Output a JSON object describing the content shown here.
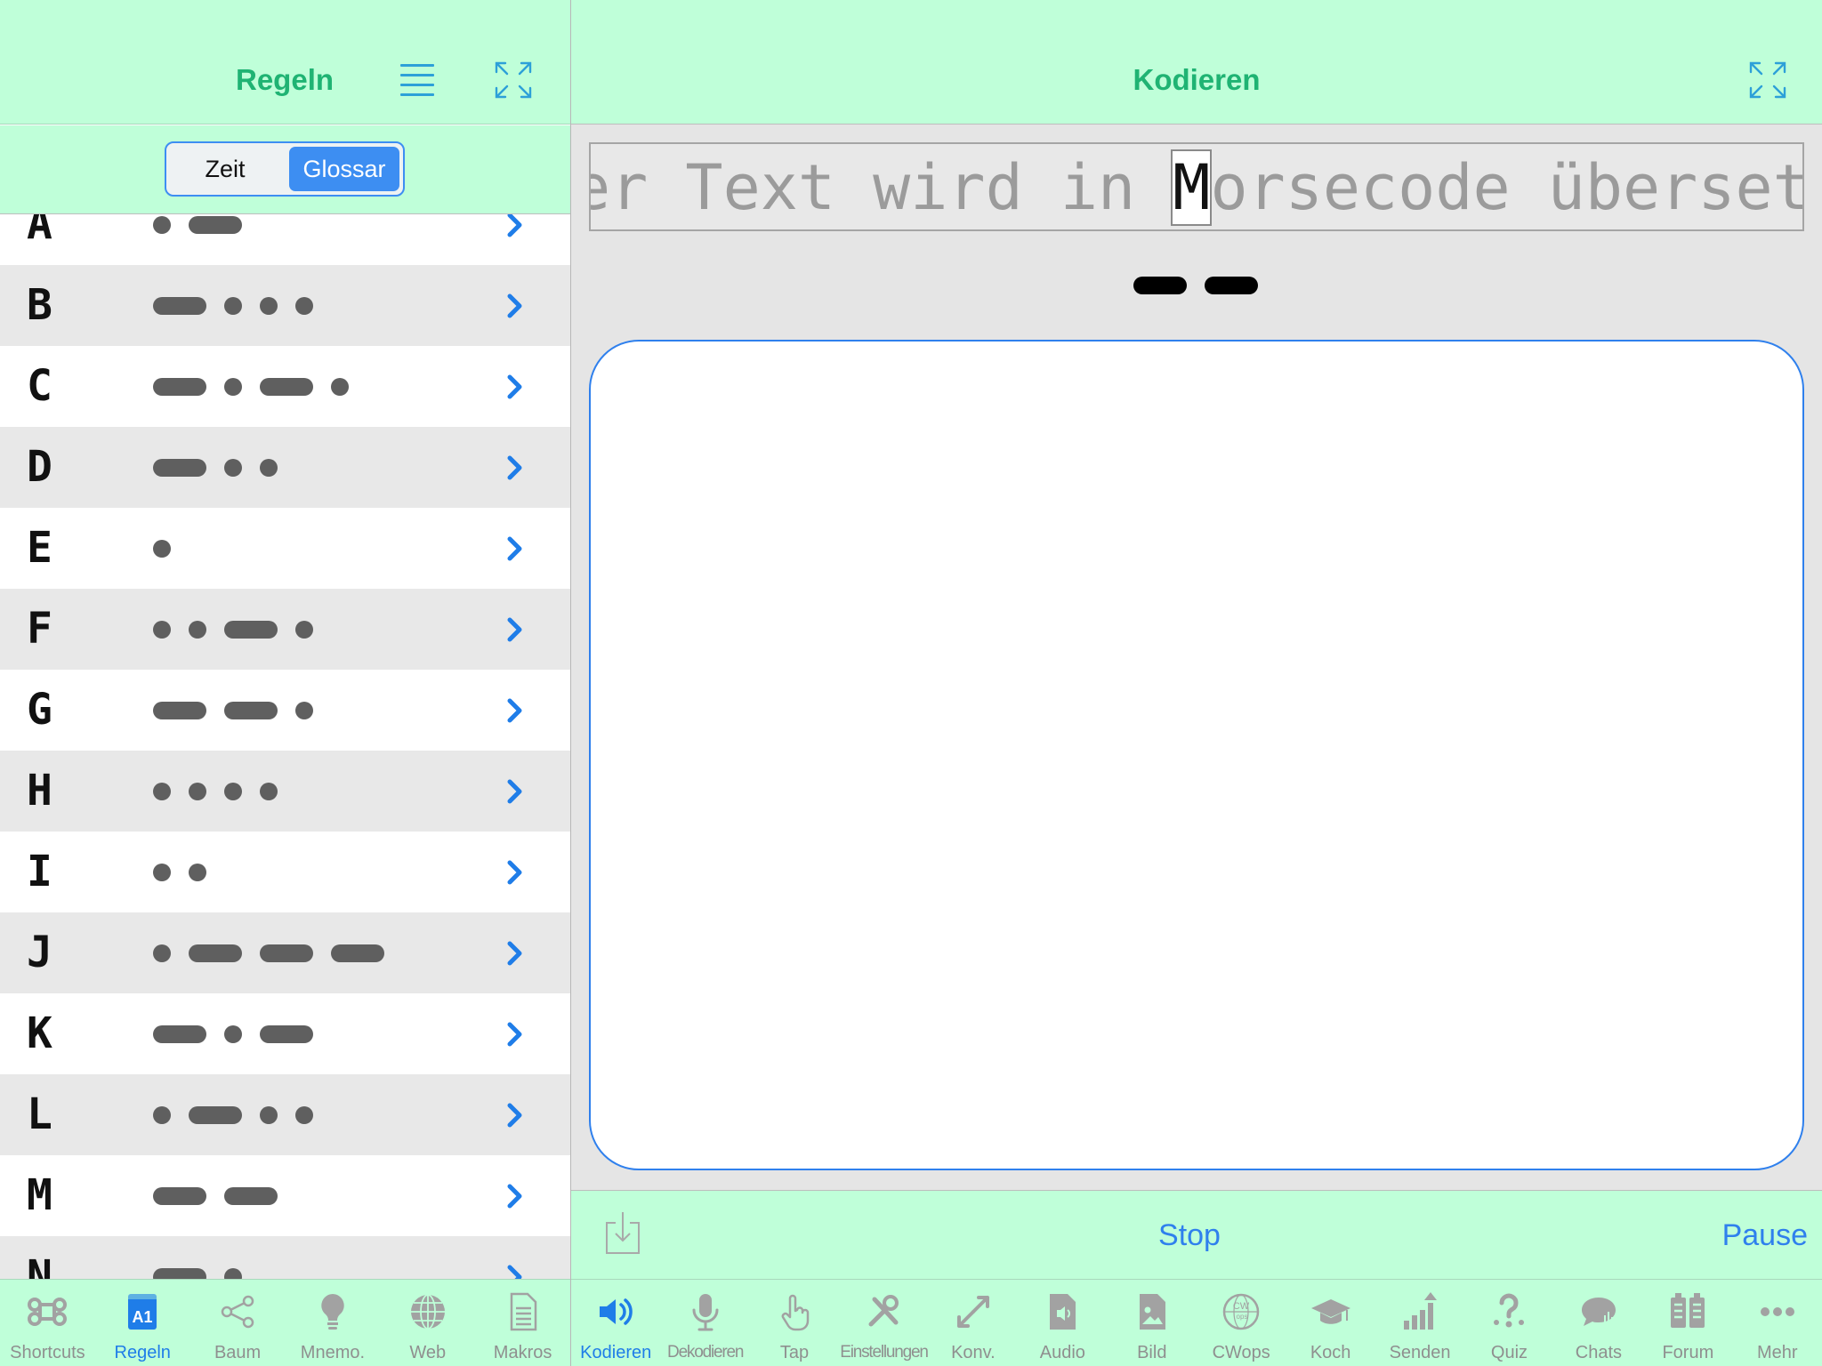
{
  "left_panel": {
    "title": "Regeln",
    "segments": [
      "Zeit",
      "Glossar"
    ],
    "selected_segment": "Glossar",
    "rows": [
      {
        "letter": "A",
        "code": ".-"
      },
      {
        "letter": "B",
        "code": "-..."
      },
      {
        "letter": "C",
        "code": "-.-."
      },
      {
        "letter": "D",
        "code": "-.."
      },
      {
        "letter": "E",
        "code": "."
      },
      {
        "letter": "F",
        "code": "..-."
      },
      {
        "letter": "G",
        "code": "--."
      },
      {
        "letter": "H",
        "code": "...."
      },
      {
        "letter": "I",
        "code": ".."
      },
      {
        "letter": "J",
        "code": ".---"
      },
      {
        "letter": "K",
        "code": "-.-"
      },
      {
        "letter": "L",
        "code": ".-.."
      },
      {
        "letter": "M",
        "code": "--"
      },
      {
        "letter": "N",
        "code": "-."
      }
    ]
  },
  "right_panel": {
    "title": "Kodieren",
    "ticker": {
      "before": "er Text wird in ",
      "current": "M",
      "after": "orsecode überset"
    },
    "current_code": "--",
    "editor_text": "",
    "actions": {
      "stop": "Stop",
      "pause": "Pause"
    }
  },
  "tabs_left": [
    {
      "label": "Shortcuts",
      "icon": "command-icon",
      "active": false
    },
    {
      "label": "Regeln",
      "icon": "rules-a1-icon",
      "active": true
    },
    {
      "label": "Baum",
      "icon": "share-tree-icon",
      "active": false
    },
    {
      "label": "Mnemo.",
      "icon": "lightbulb-icon",
      "active": false
    },
    {
      "label": "Web",
      "icon": "globe-icon",
      "active": false
    },
    {
      "label": "Makros",
      "icon": "document-icon",
      "active": false
    }
  ],
  "tabs_right": [
    {
      "label": "Kodieren",
      "icon": "speaker-icon",
      "active": true
    },
    {
      "label": "Dekodieren",
      "icon": "microphone-icon",
      "active": false
    },
    {
      "label": "Tap",
      "icon": "hand-tap-icon",
      "active": false
    },
    {
      "label": "Einstellungen",
      "icon": "tools-icon",
      "active": false
    },
    {
      "label": "Konv.",
      "icon": "convert-arrows-icon",
      "active": false
    },
    {
      "label": "Audio",
      "icon": "audio-file-icon",
      "active": false
    },
    {
      "label": "Bild",
      "icon": "image-file-icon",
      "active": false
    },
    {
      "label": "CWops",
      "icon": "cwops-globe-icon",
      "active": false
    },
    {
      "label": "Koch",
      "icon": "graduation-cap-icon",
      "active": false
    },
    {
      "label": "Senden",
      "icon": "bar-chart-upload-icon",
      "active": false
    },
    {
      "label": "Quiz",
      "icon": "question-icon",
      "active": false
    },
    {
      "label": "Chats",
      "icon": "chat-bubble-icon",
      "active": false
    },
    {
      "label": "Forum",
      "icon": "forum-boards-icon",
      "active": false
    },
    {
      "label": "Mehr",
      "icon": "more-dots-icon",
      "active": false
    }
  ],
  "colors": {
    "header_bg": "#bfffd9",
    "title_green": "#1fb373",
    "accent_blue": "#2f80ed",
    "code_gray": "#5f5f5f"
  }
}
